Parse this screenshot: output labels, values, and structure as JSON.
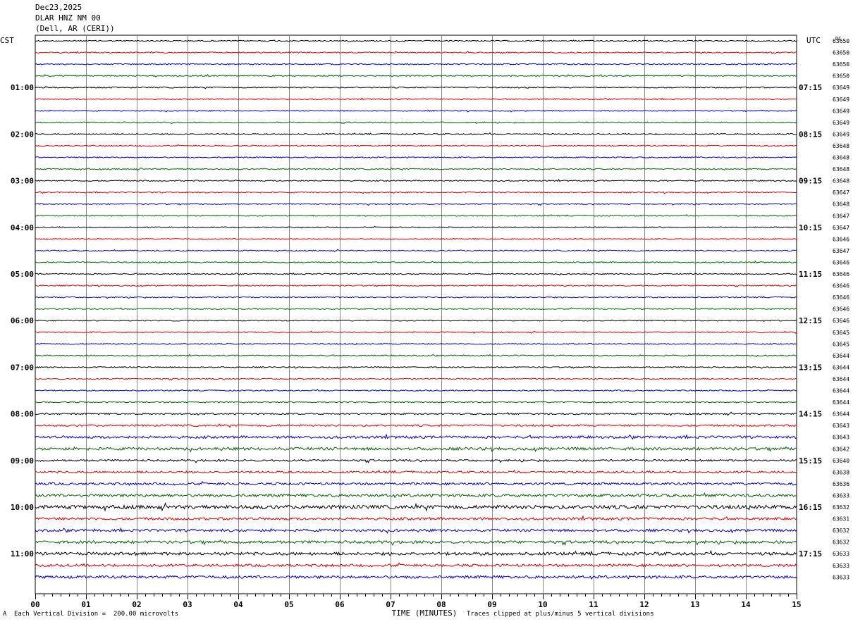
{
  "header": {
    "date": "Dec23,2025",
    "station": "DLAR HNZ NM 00",
    "location": "(Dell, AR (CERI))"
  },
  "chart_data": {
    "type": "line",
    "title": "Dec23,2025",
    "left_axis_label": "CST",
    "right_axis_label": "UTC",
    "dc_label": "DC",
    "xlabel": "TIME (MINUTES)",
    "x_ticks": [
      "00",
      "01",
      "02",
      "03",
      "04",
      "05",
      "06",
      "07",
      "08",
      "09",
      "10",
      "11",
      "12",
      "13",
      "14",
      "15"
    ],
    "xlim": [
      0,
      15
    ],
    "grid": true,
    "trace_colors": [
      "#000000",
      "#dd0000",
      "#0000cc",
      "#006600"
    ],
    "left_hour_labels": [
      "01:00",
      "02:00",
      "03:00",
      "04:00",
      "05:00",
      "06:00",
      "07:00",
      "08:00",
      "09:00",
      "10:00",
      "11:00"
    ],
    "right_hour_labels": [
      "07:15",
      "08:15",
      "09:15",
      "10:15",
      "11:15",
      "12:15",
      "13:15",
      "14:15",
      "15:15",
      "16:15",
      "17:15"
    ],
    "dc_offsets": [
      63650,
      63650,
      63650,
      63650,
      63649,
      63649,
      63649,
      63649,
      63649,
      63648,
      63648,
      63648,
      63648,
      63647,
      63648,
      63647,
      63647,
      63646,
      63647,
      63646,
      63646,
      63646,
      63646,
      63646,
      63646,
      63645,
      63645,
      63644,
      63644,
      63644,
      63644,
      63644,
      63644,
      63643,
      63643,
      63642,
      63640,
      63638,
      63636,
      63633,
      63632,
      63631,
      63632,
      63632,
      63633,
      63633,
      63633
    ],
    "trace_amplitude": [
      1.0,
      1.0,
      1.0,
      1.0,
      1.0,
      1.0,
      1.0,
      1.0,
      1.1,
      1.0,
      1.0,
      1.0,
      1.0,
      1.0,
      1.0,
      1.0,
      1.0,
      1.0,
      1.0,
      1.0,
      1.0,
      1.0,
      1.0,
      1.0,
      1.0,
      1.0,
      1.0,
      1.0,
      1.0,
      1.0,
      1.0,
      1.0,
      1.4,
      1.6,
      2.2,
      2.4,
      1.7,
      1.8,
      2.0,
      2.4,
      3.2,
      2.2,
      2.2,
      2.4,
      2.6,
      2.2,
      2.4
    ],
    "traces_count": 47
  },
  "footer": {
    "scale_note": "Each Vertical Division =  200.00 microvolts",
    "clip_note": "Traces clipped at plus/minus 5 vertical divisions",
    "marker": "A"
  }
}
